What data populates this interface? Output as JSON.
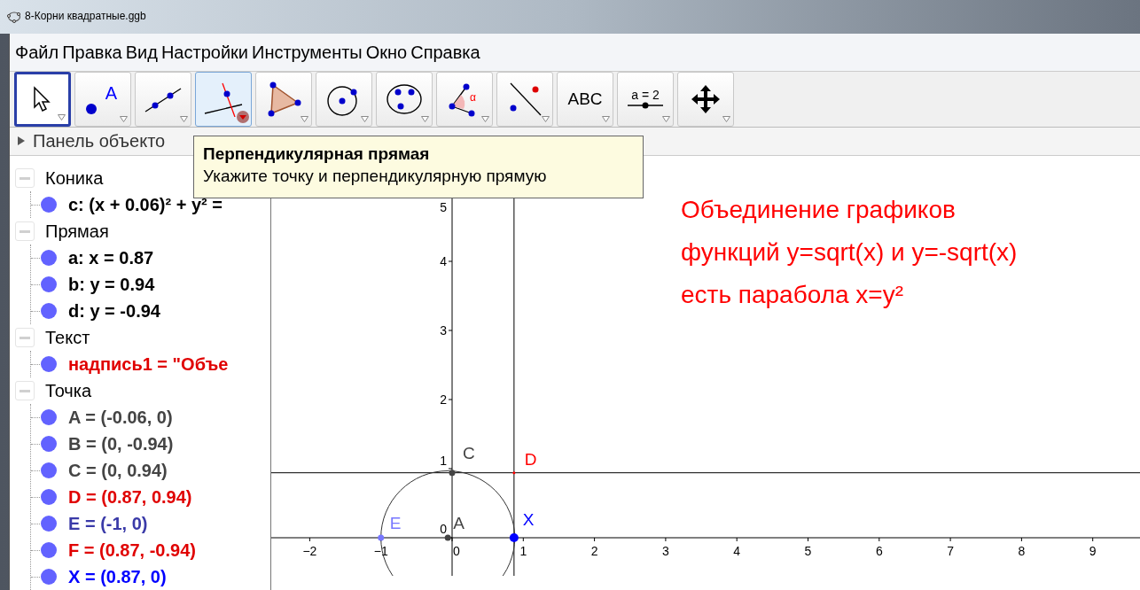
{
  "window": {
    "title": "8-Корни квадратные.ggb"
  },
  "menu": [
    "Файл",
    "Правка",
    "Вид",
    "Настройки",
    "Инструменты",
    "Окно",
    "Справка"
  ],
  "tools": [
    {
      "kind": "pointer",
      "selected": true,
      "hovered": false
    },
    {
      "kind": "point",
      "selected": false,
      "hovered": false,
      "label": "A"
    },
    {
      "kind": "line",
      "selected": false,
      "hovered": false
    },
    {
      "kind": "perpendicular",
      "selected": false,
      "hovered": true
    },
    {
      "kind": "polygon",
      "selected": false,
      "hovered": false
    },
    {
      "kind": "circle",
      "selected": false,
      "hovered": false
    },
    {
      "kind": "conic",
      "selected": false,
      "hovered": false
    },
    {
      "kind": "angle",
      "selected": false,
      "hovered": false,
      "label": "α"
    },
    {
      "kind": "reflect",
      "selected": false,
      "hovered": false
    },
    {
      "kind": "text",
      "selected": false,
      "hovered": false,
      "label": "ABC"
    },
    {
      "kind": "slider",
      "selected": false,
      "hovered": false,
      "label": "a = 2"
    },
    {
      "kind": "move",
      "selected": false,
      "hovered": false
    }
  ],
  "tooltip": {
    "title": "Перпендикулярная прямая",
    "description": "Укажите точку и перпендикулярную прямую"
  },
  "algebra_panel": {
    "title": "Панель объекто",
    "expanded": false,
    "groups": [
      {
        "label": "Коника",
        "expanded": true,
        "children": [
          {
            "text": "c: (x + 0.06)² + y² =",
            "color": "#000000"
          }
        ]
      },
      {
        "label": "Прямая",
        "expanded": true,
        "children": [
          {
            "text": "a: x = 0.87",
            "color": "#000000"
          },
          {
            "text": "b: y = 0.94",
            "color": "#000000"
          },
          {
            "text": "d: y = -0.94",
            "color": "#000000"
          }
        ]
      },
      {
        "label": "Текст",
        "expanded": true,
        "children": [
          {
            "text": "надпись1 = \"Объе",
            "color": "#e00000"
          }
        ]
      },
      {
        "label": "Точка",
        "expanded": true,
        "children": [
          {
            "text": "A = (-0.06, 0)",
            "color": "#444444"
          },
          {
            "text": "B = (0, -0.94)",
            "color": "#444444"
          },
          {
            "text": "C = (0, 0.94)",
            "color": "#444444"
          },
          {
            "text": "D = (0.87, 0.94)",
            "color": "#e00000"
          },
          {
            "text": "E = (-1, 0)",
            "color": "#3a3aa8"
          },
          {
            "text": "F = (0.87, -0.94)",
            "color": "#e00000"
          },
          {
            "text": "X = (0.87, 0)",
            "color": "#0000ff"
          }
        ]
      }
    ]
  },
  "graphics": {
    "x_labels": [
      "−2",
      "−1",
      "0",
      "1",
      "2",
      "3",
      "4",
      "5",
      "6",
      "7",
      "8",
      "9"
    ],
    "y_labels": [
      "5",
      "4",
      "3",
      "2",
      "1",
      "0"
    ],
    "points": [
      {
        "label": "C",
        "color": "#444444"
      },
      {
        "label": "D",
        "color": "#ff0000"
      },
      {
        "label": "E",
        "color": "#7777ff"
      },
      {
        "label": "A",
        "color": "#444444"
      },
      {
        "label": "X",
        "color": "#0000ff"
      }
    ],
    "text_lines": [
      "Объединение графиков",
      "функций y=sqrt(x) и y=-sqrt(x)",
      "есть парабола x=y²"
    ]
  }
}
